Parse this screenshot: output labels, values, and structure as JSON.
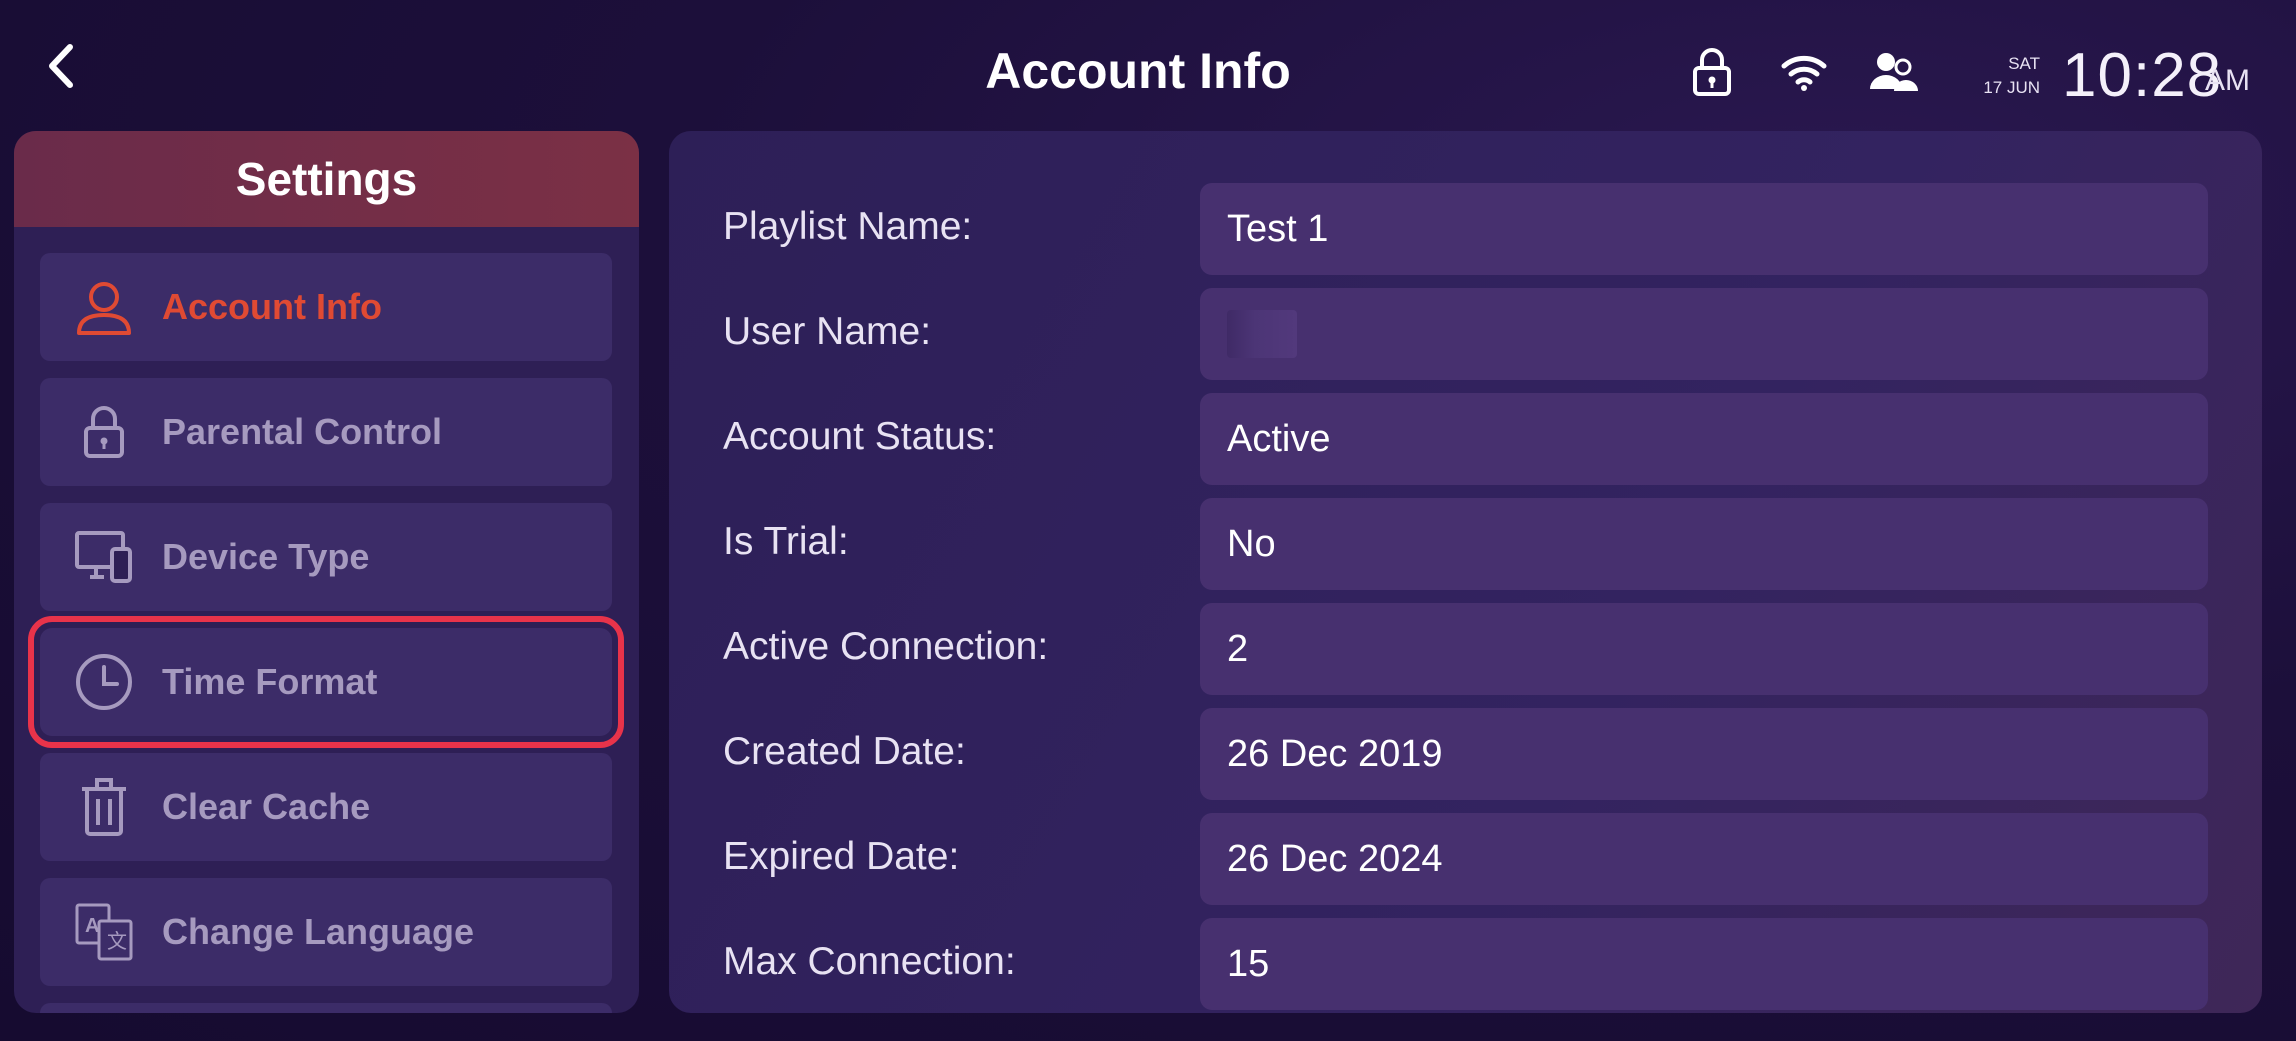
{
  "header": {
    "title": "Account Info",
    "date_day": "SAT",
    "date_date": "17 JUN",
    "time": "10:28",
    "ampm": "AM",
    "icons": [
      "lock-icon",
      "wifi-icon",
      "users-icon"
    ]
  },
  "sidebar": {
    "title": "Settings",
    "items": [
      {
        "label": "Account Info",
        "icon": "user-icon",
        "state": "active"
      },
      {
        "label": "Parental Control",
        "icon": "lock-icon",
        "state": "normal"
      },
      {
        "label": "Device Type",
        "icon": "devices-icon",
        "state": "normal"
      },
      {
        "label": "Time Format",
        "icon": "clock-icon",
        "state": "focused"
      },
      {
        "label": "Clear Cache",
        "icon": "trash-icon",
        "state": "normal"
      },
      {
        "label": "Change Language",
        "icon": "language-icon",
        "state": "normal"
      }
    ]
  },
  "account": {
    "rows": [
      {
        "label": "Playlist Name:",
        "value": "Test 1"
      },
      {
        "label": "User Name:",
        "value": ""
      },
      {
        "label": "Account Status:",
        "value": "Active"
      },
      {
        "label": "Is Trial:",
        "value": "No"
      },
      {
        "label": "Active Connection:",
        "value": "2"
      },
      {
        "label": "Created Date:",
        "value": "26 Dec 2019"
      },
      {
        "label": "Expired Date:",
        "value": "26 Dec 2024"
      },
      {
        "label": "Max Connection:",
        "value": "15"
      }
    ]
  },
  "colors": {
    "active_item": "#e04a33",
    "focus_outline": "#e8334a",
    "inactive_text": "#a69abf"
  }
}
